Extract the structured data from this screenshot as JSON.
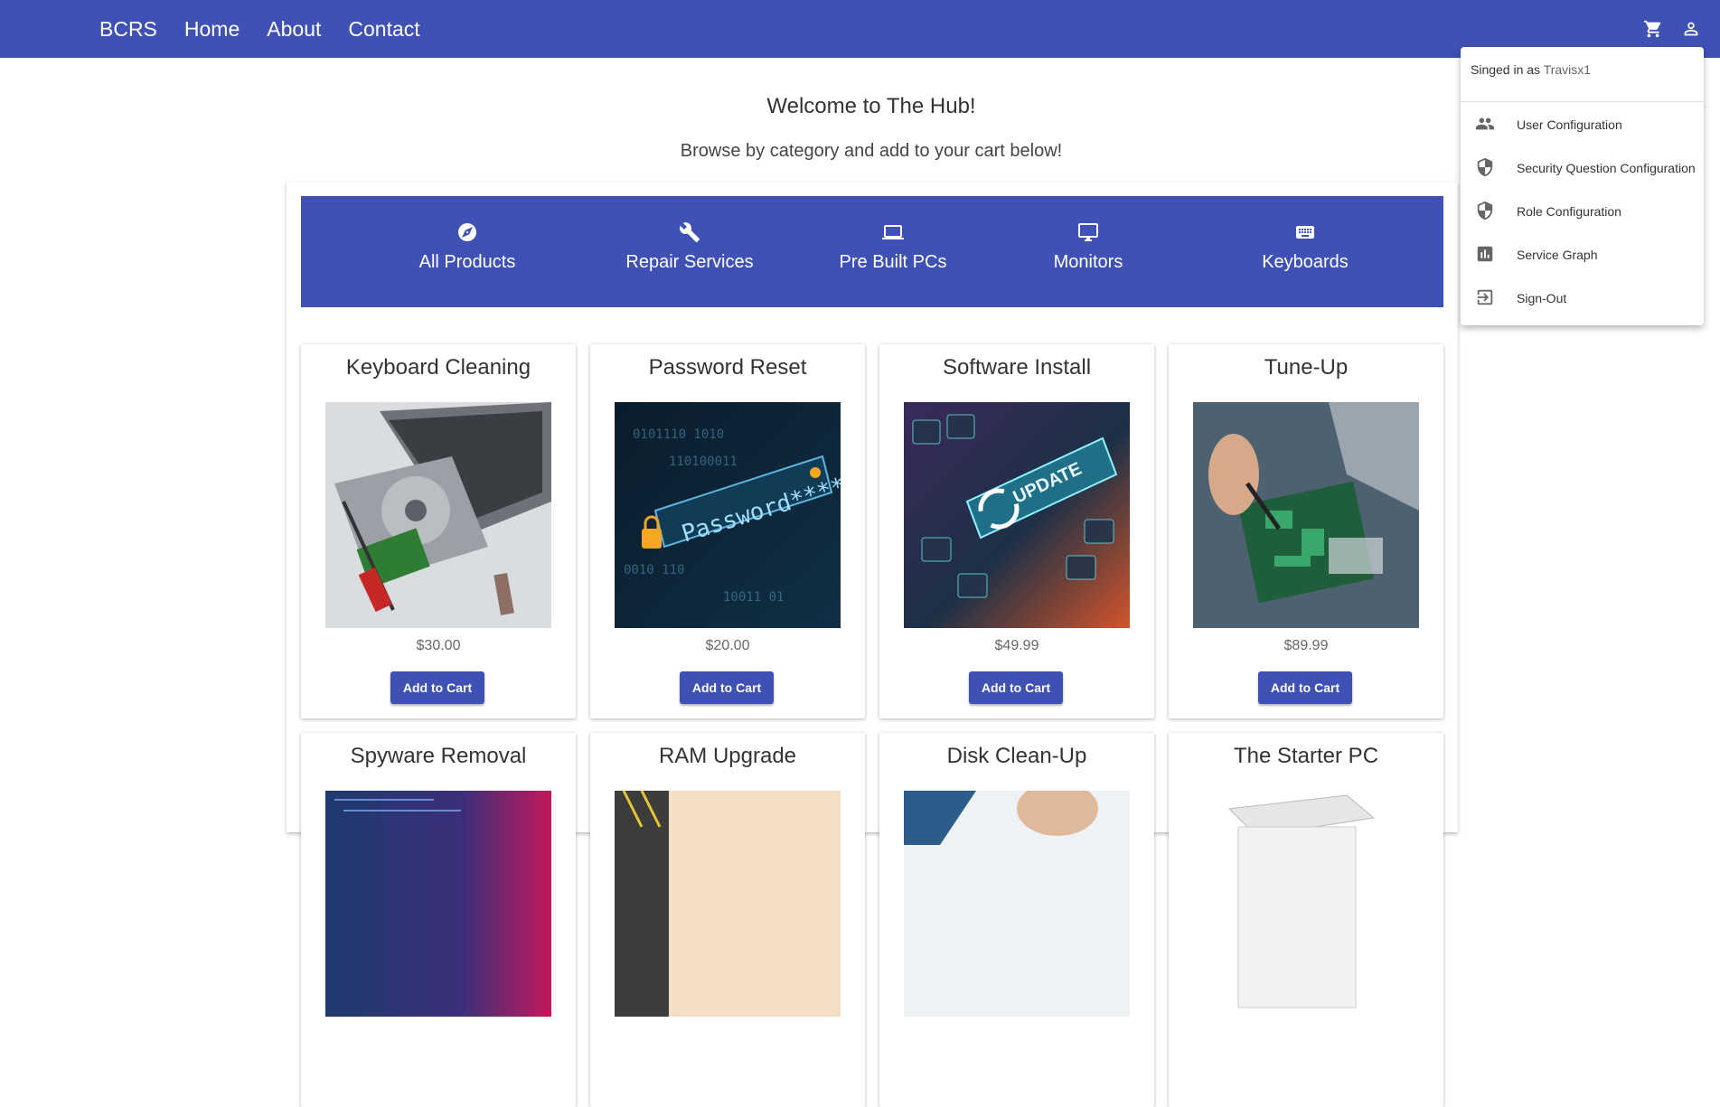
{
  "nav": {
    "brand": "BCRS",
    "home": "Home",
    "about": "About",
    "contact": "Contact",
    "icons": [
      "cart-icon",
      "account-icon"
    ]
  },
  "welcome": "Welcome to The Hub!",
  "browse": "Browse by category and add to your cart below!",
  "categories": [
    {
      "label": "All Products",
      "icon": "compass-icon"
    },
    {
      "label": "Repair Services",
      "icon": "wrench-icon"
    },
    {
      "label": "Pre Built PCs",
      "icon": "laptop-icon"
    },
    {
      "label": "Monitors",
      "icon": "monitor-icon"
    },
    {
      "label": "Keyboards",
      "icon": "keyboard-icon"
    }
  ],
  "products": [
    {
      "title": "Keyboard Cleaning",
      "price": "$30.00",
      "button": "Add to Cart"
    },
    {
      "title": "Password Reset",
      "price": "$20.00",
      "button": "Add to Cart"
    },
    {
      "title": "Software Install",
      "price": "$49.99",
      "button": "Add to Cart"
    },
    {
      "title": "Tune-Up",
      "price": "$89.99",
      "button": "Add to Cart"
    },
    {
      "title": "Spyware Removal"
    },
    {
      "title": "RAM Upgrade"
    },
    {
      "title": "Disk Clean-Up"
    },
    {
      "title": "The Starter PC"
    }
  ],
  "menu": {
    "signed_prefix": "Singed in as",
    "username": "Travisx1",
    "items": [
      {
        "label": "User Configuration",
        "icon": "people-icon"
      },
      {
        "label": "Security Question Configuration",
        "icon": "shield-icon"
      },
      {
        "label": "Role Configuration",
        "icon": "shield-icon"
      },
      {
        "label": "Service Graph",
        "icon": "bar-chart-icon"
      },
      {
        "label": "Sign-Out",
        "icon": "logout-icon"
      }
    ]
  },
  "colors": {
    "primary": "#3f51b5"
  }
}
